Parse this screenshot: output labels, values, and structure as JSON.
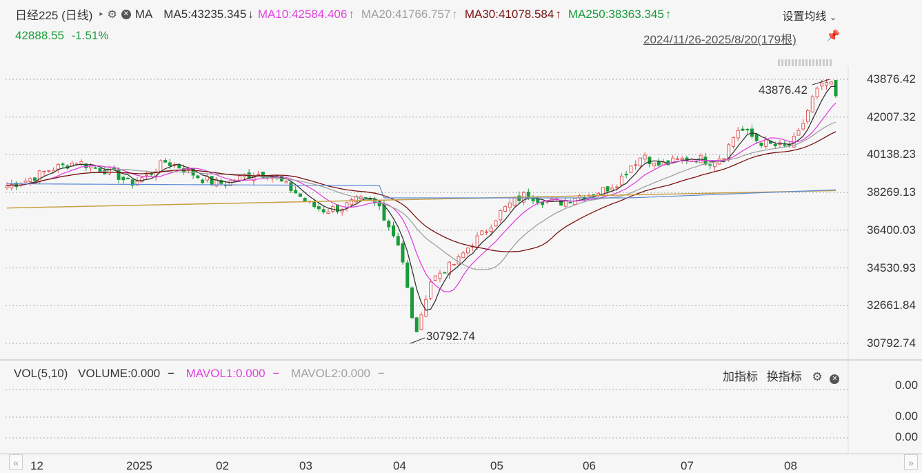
{
  "header": {
    "title": "日经225 (日线)",
    "ma_label": "MA",
    "ma5": "MA5:43235.345",
    "ma5_dir": "↓",
    "ma10": "MA10:42584.406",
    "ma10_dir": "↑",
    "ma20": "MA20:41766.757",
    "ma20_dir": "↑",
    "ma30": "MA30:41078.584",
    "ma30_dir": "↑",
    "ma250": "MA250:38363.345",
    "ma250_dir": "↑",
    "settings_label": "设置均线",
    "price": "42888.55",
    "change": "-1.51%",
    "date_range": "2024/11/26-2025/8/20(179根)"
  },
  "volume_panel": {
    "label": "VOL(5,10)",
    "volume": "VOLUME:0.000",
    "mavol1": "MAVOL1:0.000",
    "mavol2": "MAVOL2:0.000",
    "add_indicator": "加指标",
    "switch_indicator": "换指标",
    "y_ticks": [
      "0.00",
      "0.00",
      "0.00"
    ]
  },
  "colors": {
    "up": "#e05a5a",
    "down": "#1a9b3a",
    "ma5": "#333333",
    "ma10": "#e040e0",
    "ma20": "#a0a0a0",
    "ma30": "#7a1010",
    "ma250": "#c8a040",
    "ma_blue": "#5a8ad8"
  },
  "chart_data": {
    "type": "candlestick",
    "y_ticks": [
      "43876.42",
      "42007.32",
      "40138.23",
      "38269.13",
      "36400.03",
      "34530.93",
      "32661.84",
      "30792.74"
    ],
    "ylim": [
      30792.74,
      43876.42
    ],
    "x_ticks": [
      "12",
      "2025",
      "02",
      "03",
      "04",
      "05",
      "06",
      "07",
      "08"
    ],
    "annotations": {
      "high": "43876.42",
      "low": "30792.74"
    },
    "bar_count": 179,
    "ohlc_keypoints": [
      [
        0,
        38600
      ],
      [
        6,
        38900
      ],
      [
        12,
        39400
      ],
      [
        20,
        39800
      ],
      [
        25,
        39500
      ],
      [
        30,
        39300
      ],
      [
        35,
        38700
      ],
      [
        40,
        39100
      ],
      [
        45,
        39800
      ],
      [
        50,
        39500
      ],
      [
        55,
        39000
      ],
      [
        58,
        38800
      ],
      [
        62,
        38700
      ],
      [
        65,
        38900
      ],
      [
        70,
        39200
      ],
      [
        75,
        39200
      ],
      [
        78,
        38800
      ],
      [
        82,
        38300
      ],
      [
        86,
        37700
      ],
      [
        90,
        37400
      ],
      [
        95,
        37500
      ],
      [
        100,
        37900
      ],
      [
        103,
        37800
      ],
      [
        106,
        37600
      ],
      [
        110,
        36200
      ],
      [
        112,
        35600
      ],
      [
        114,
        33500
      ],
      [
        116,
        31200
      ],
      [
        118,
        32000
      ],
      [
        120,
        33800
      ],
      [
        124,
        34400
      ],
      [
        128,
        34800
      ],
      [
        132,
        35700
      ],
      [
        136,
        36300
      ],
      [
        140,
        37200
      ],
      [
        144,
        37800
      ],
      [
        148,
        38200
      ],
      [
        152,
        37900
      ],
      [
        155,
        37800
      ],
      [
        158,
        37800
      ],
      [
        162,
        38100
      ],
      [
        166,
        38200
      ],
      [
        170,
        38400
      ],
      [
        174,
        38800
      ],
      [
        178,
        39700
      ],
      [
        182,
        40200
      ],
      [
        184,
        39600
      ],
      [
        188,
        39700
      ],
      [
        192,
        39900
      ],
      [
        196,
        40000
      ],
      [
        200,
        39800
      ],
      [
        204,
        40100
      ],
      [
        208,
        41400
      ],
      [
        210,
        41300
      ],
      [
        214,
        40800
      ],
      [
        218,
        40600
      ],
      [
        222,
        40500
      ],
      [
        225,
        41000
      ],
      [
        228,
        42300
      ],
      [
        230,
        43200
      ],
      [
        232,
        43500
      ],
      [
        234,
        43800
      ],
      [
        236,
        43000
      ]
    ],
    "ma_series": [
      {
        "name": "MA5",
        "value": "43235.345"
      },
      {
        "name": "MA10",
        "value": "42584.406"
      },
      {
        "name": "MA20",
        "value": "41766.757"
      },
      {
        "name": "MA30",
        "value": "41078.584"
      },
      {
        "name": "MA250",
        "value": "38363.345"
      }
    ]
  }
}
